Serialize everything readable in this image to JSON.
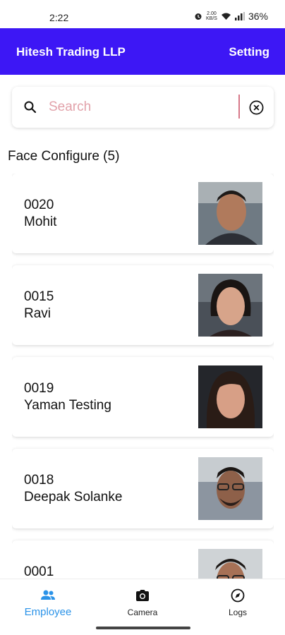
{
  "status": {
    "time": "2:22",
    "net_rate": "2.00",
    "net_unit": "KB/S",
    "battery": "36%"
  },
  "header": {
    "title": "Hitesh Trading LLP",
    "setting_label": "Setting",
    "color": "#3d17f5"
  },
  "search": {
    "placeholder": "Search",
    "value": ""
  },
  "section": {
    "title": "Face Configure (5)"
  },
  "employees": [
    {
      "code": "0020",
      "name": "Mohit"
    },
    {
      "code": "0015",
      "name": "Ravi"
    },
    {
      "code": "0019",
      "name": "Yaman Testing"
    },
    {
      "code": "0018",
      "name": "Deepak Solanke"
    },
    {
      "code": "0001",
      "name": ""
    }
  ],
  "nav": {
    "active_color": "#2b93e8",
    "items": [
      {
        "label": "Employee",
        "icon": "people-icon"
      },
      {
        "label": "Camera",
        "icon": "camera-icon"
      },
      {
        "label": "Logs",
        "icon": "compass-icon"
      }
    ]
  }
}
